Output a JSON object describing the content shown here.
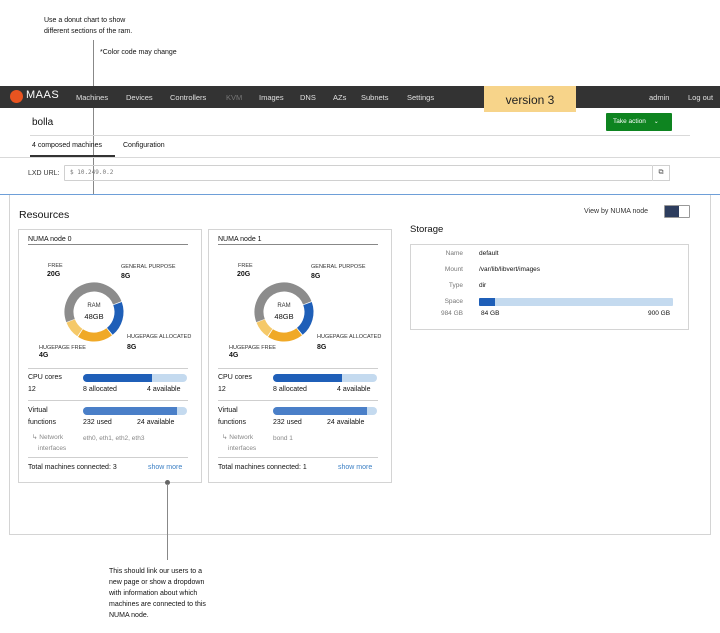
{
  "annotations": {
    "donut_note_line1": "Use a donut chart to show",
    "donut_note_line2": "different sections of the ram.",
    "color_note": "*Color code may change",
    "link_note_lines": [
      "This should link our users to a",
      "new page or show a dropdown",
      "with information about which",
      "machines are connected to this",
      "NUMA node."
    ]
  },
  "nav": {
    "logo": "MAAS",
    "items": [
      "Machines",
      "Devices",
      "Controllers",
      "KVM",
      "Images",
      "DNS",
      "AZs",
      "Subnets",
      "Settings"
    ],
    "user": "admin",
    "logout": "Log out",
    "version": "version 3"
  },
  "header": {
    "title": "bolla",
    "take_action": "Take action",
    "tabs": [
      "4 composed machines",
      "Configuration"
    ]
  },
  "lxd": {
    "label": "LXD URL:",
    "value": "$ 10.249.0.2"
  },
  "resources": {
    "title": "Resources",
    "view_toggle_label": "View by NUMA node",
    "view_toggle_on": true
  },
  "numa_nodes": [
    {
      "title": "NUMA node 0",
      "ram": {
        "center_label": "RAM",
        "center_value": "48GB",
        "free": {
          "label": "FREE",
          "value": "20G"
        },
        "general": {
          "label": "GENERAL  PURPOSE",
          "value": "8G"
        },
        "hugepage_free": {
          "label": "HUGEPAGE FREE",
          "value": "4G"
        },
        "hugepage_allocated": {
          "label": "HUGEPAGE ALLOCATED",
          "value": "8G"
        }
      },
      "cpu": {
        "label": "CPU cores",
        "total": "12",
        "allocated": "8 allocated",
        "available": "4 available",
        "fraction": 0.667
      },
      "vf": {
        "label1": "Virtual",
        "label2": "functions",
        "used": "232 used",
        "available": "24 available",
        "fraction": 0.906
      },
      "interfaces": {
        "label1": "Network",
        "label2": "interfaces",
        "value": "eth0, eth1, eth2, eth3"
      },
      "machines": "Total machines connected: 3",
      "show_more": "show more"
    },
    {
      "title": "NUMA node 1",
      "ram": {
        "center_label": "RAM",
        "center_value": "48GB",
        "free": {
          "label": "FREE",
          "value": "20G"
        },
        "general": {
          "label": "GENERAL  PURPOSE",
          "value": "8G"
        },
        "hugepage_free": {
          "label": "HUGEPAGE FREE",
          "value": "4G"
        },
        "hugepage_allocated": {
          "label": "HUGEPAGE ALLOCATED",
          "value": "8G"
        }
      },
      "cpu": {
        "label": "CPU cores",
        "total": "12",
        "allocated": "8 allocated",
        "available": "4 available",
        "fraction": 0.667
      },
      "vf": {
        "label1": "Virtual",
        "label2": "functions",
        "used": "232 used",
        "available": "24 available",
        "fraction": 0.906
      },
      "interfaces": {
        "label1": "Network",
        "label2": "interfaces",
        "value": "bond 1"
      },
      "machines": "Total machines connected: 1",
      "show_more": "show more"
    }
  ],
  "ram_segments": [
    {
      "key": "free",
      "gb": 20,
      "color": "#8c8c8c"
    },
    {
      "key": "general",
      "gb": 8,
      "color": "#1f5fb8"
    },
    {
      "key": "hugepage_allocated",
      "gb": 8,
      "color": "#f0a927"
    },
    {
      "key": "hugepage_free",
      "gb": 4,
      "color": "#f5c969"
    }
  ],
  "storage": {
    "title": "Storage",
    "name_label": "Name",
    "name": "default",
    "mount_label": "Mount",
    "mount": "/var/lib/libvert/images",
    "type_label": "Type",
    "type": "dir",
    "space_label": "Space",
    "space_total": "984 GB",
    "space_used": "84 GB",
    "space_free": "900 GB",
    "space_fraction": 0.085
  },
  "colors": {
    "nav_bg": "#333333",
    "brand": "#e95420",
    "action": "#0e8420",
    "link": "#3b7fc4",
    "bar": "#1f5fb8",
    "bar_track": "#c4daef"
  }
}
